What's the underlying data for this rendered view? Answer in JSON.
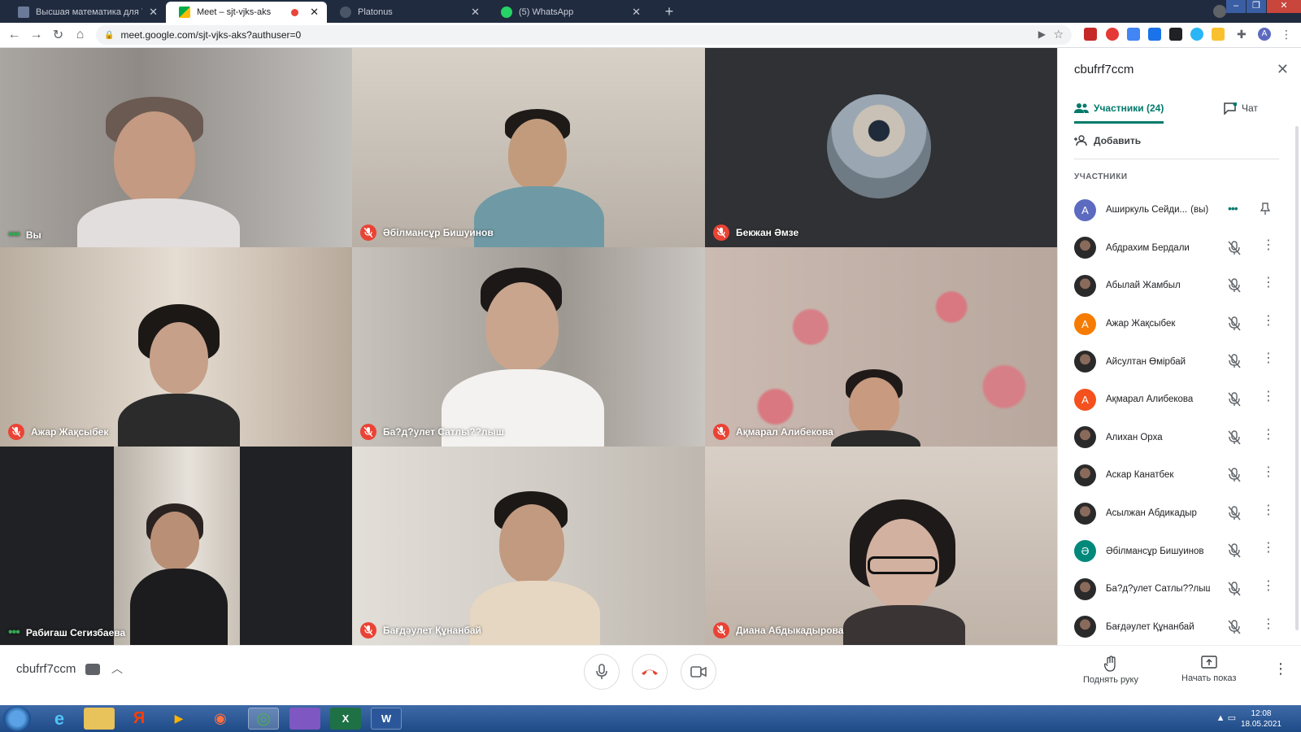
{
  "browser": {
    "tabs": [
      {
        "title": "Высшая математика для ТЭ",
        "active": false
      },
      {
        "title": "Meet – sjt-vjks-aks",
        "active": true
      },
      {
        "title": "Platonus",
        "active": false
      },
      {
        "title": "(5) WhatsApp",
        "active": false
      }
    ],
    "url": "meet.google.com/sjt-vjks-aks?authuser=0",
    "profile_initial": "A"
  },
  "grid": {
    "tiles": [
      {
        "name": "Вы",
        "status": "speaking",
        "bg": "#9a9590"
      },
      {
        "name": "Әбілмансұр Бишуинов",
        "status": "muted",
        "bg": "#c9c1b7"
      },
      {
        "name": "Бекжан Әмзе",
        "status": "muted",
        "bg": "#303134"
      },
      {
        "name": "Ажар Жақсыбек",
        "status": "muted",
        "bg": "#cfc6bb"
      },
      {
        "name": "Ба?д?улет Сатлы??лыш",
        "status": "muted",
        "bg": "#b7b1aa"
      },
      {
        "name": "Ақмарал Алибекова",
        "status": "muted",
        "bg": "#b99a90"
      },
      {
        "name": "Рабигаш Сегизбаева",
        "status": "speaking",
        "bg": "#202124"
      },
      {
        "name": "Бағдәулет Құнанбай",
        "status": "muted",
        "bg": "#cfcac3"
      },
      {
        "name": "Диана Абдыкадырова",
        "status": "muted",
        "bg": "#c7bbb0"
      }
    ]
  },
  "panel": {
    "title": "cbufrf7ccm",
    "tab_participants": "Участники (24)",
    "tab_chat": "Чат",
    "add_label": "Добавить",
    "section_label": "УЧАСТНИКИ",
    "participants": [
      {
        "name": "Аширкуль Сейди...",
        "you": "(вы)",
        "avatar": "A",
        "avatar_color": "#5c6bc0",
        "photo": false
      },
      {
        "name": "Абдрахим Бердали",
        "avatar": "",
        "photo": true
      },
      {
        "name": "Абылай Жамбыл",
        "avatar": "",
        "photo": true
      },
      {
        "name": "Ажар Жақсыбек",
        "avatar": "А",
        "avatar_color": "#f57c00",
        "photo": false
      },
      {
        "name": "Айсултан Өмірбай",
        "avatar": "",
        "photo": true
      },
      {
        "name": "Ақмарал Алибекова",
        "avatar": "А",
        "avatar_color": "#f4511e",
        "photo": false
      },
      {
        "name": "Алихан Орха",
        "avatar": "",
        "photo": true
      },
      {
        "name": "Аскар Канатбек",
        "avatar": "",
        "photo": true
      },
      {
        "name": "Асылжан Абдикадыр",
        "avatar": "",
        "photo": true
      },
      {
        "name": "Әбілмансұр Бишуинов",
        "avatar": "Ә",
        "avatar_color": "#00897b",
        "photo": false
      },
      {
        "name": "Ба?д?улет Сатлы??лыш",
        "avatar": "",
        "photo": true
      },
      {
        "name": "Бағдәулет Құнанбай",
        "avatar": "",
        "photo": true
      }
    ]
  },
  "bottom": {
    "meeting_code": "cbufrf7ccm",
    "raise_hand": "Поднять руку",
    "present": "Начать показ"
  },
  "taskbar": {
    "time": "12:08",
    "date": "18.05.2021"
  },
  "colors": {
    "accent": "#00796b",
    "end_call": "#ea4335",
    "muted_badge": "#ea4335"
  }
}
